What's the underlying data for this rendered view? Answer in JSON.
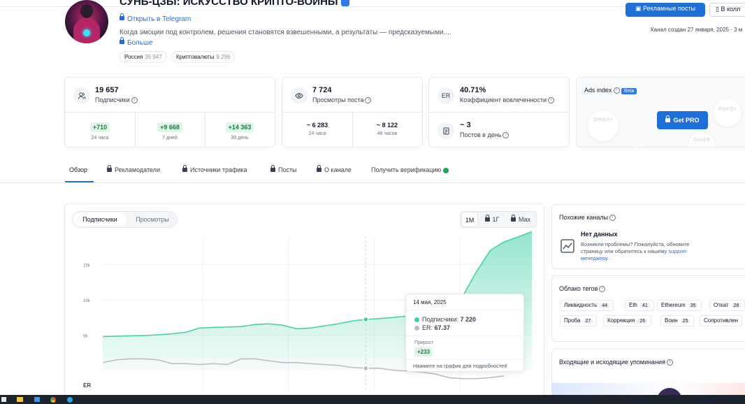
{
  "channel": {
    "title": "СУНЬ-ЦЗЫ: ИСКУССТВО КРИПТО-ВОЙНЫ",
    "telegram_link": "Открыть в Telegram",
    "description": "Когда эмоции под контролем, решения становятся взвешенными, а результаты — предсказуемыми....",
    "more": "Больше",
    "tags": [
      {
        "label": "Россия",
        "count": "35 947"
      },
      {
        "label": "Криптовалюты",
        "count": "9 296"
      }
    ],
    "ads_button": "Рекламные посты",
    "collection_button": "В колл",
    "created": "Канал создан 27 января, 2025 · 3 м"
  },
  "stats": {
    "subscribers": {
      "value": "19 657",
      "label": "Подписчики",
      "cells": [
        {
          "value": "+710",
          "label": "24 часа"
        },
        {
          "value": "+9 668",
          "label": "7 дней"
        },
        {
          "value": "+14 363",
          "label": "30 день"
        }
      ]
    },
    "views": {
      "value": "7 724",
      "label": "Просмотры поста",
      "cells": [
        {
          "value": "~ 6 283",
          "label": "24 часа"
        },
        {
          "value": "~ 8 122",
          "label": "48 часов"
        }
      ]
    },
    "er": {
      "icon_text": "ER",
      "value": "40.71%",
      "label": "Коэффициент вовлеченности"
    },
    "posts": {
      "value": "~ 3",
      "label": "Постов в день"
    },
    "ads_index": {
      "label": "Ads index",
      "beta": "Beta",
      "button": "Get PRO",
      "grades": [
        "Great A+",
        "Good B",
        "Poor D+"
      ]
    }
  },
  "tabs": [
    {
      "label": "Обзор",
      "locked": false,
      "active": true
    },
    {
      "label": "Рекламодатели",
      "locked": true
    },
    {
      "label": "Источники трафика",
      "locked": true
    },
    {
      "label": "Посты",
      "locked": true
    },
    {
      "label": "О канале",
      "locked": true
    },
    {
      "label": "Получить верификацию",
      "locked": false
    }
  ],
  "chart_controls": {
    "toggle": [
      "Подписчики",
      "Просмотры"
    ],
    "ranges": [
      "1М",
      "1Г",
      "Max"
    ]
  },
  "chart_data": {
    "type": "area",
    "ytick_labels": [
      "15k",
      "10k",
      "5k"
    ],
    "y_axis_label": "ER",
    "ylim": [
      0,
      19000
    ],
    "grid": true,
    "series": [
      {
        "name": "Подписчики",
        "values": [
          4800,
          4850,
          4900,
          4950,
          5050,
          5200,
          5400,
          6000,
          6100,
          6150,
          6200,
          6500,
          6600,
          6400,
          5900,
          6000,
          6300,
          6600,
          7000,
          7220,
          7350,
          7500,
          7700,
          8000,
          8400,
          9000,
          10500,
          14000,
          17000,
          18200,
          18900,
          19657
        ]
      },
      {
        "name": "ER",
        "values": [
          3.2,
          3.5,
          3.6,
          3.6,
          3.5,
          3.1,
          3.1,
          3.0,
          3.1,
          3.0,
          3.6,
          3.6,
          3.4,
          3.2,
          3.2,
          3.1,
          3.0,
          2.9,
          2.7,
          2.6,
          2.6,
          2.4,
          2.3,
          2.2,
          2.0,
          1.6,
          1.5,
          1.5,
          1.6,
          1.8
        ]
      }
    ],
    "highlight_index": 19
  },
  "tooltip": {
    "date": "14 мая, 2025",
    "subs_label": "Подписчики:",
    "subs_value": "7 220",
    "er_label": "ER:",
    "er_value": "67.37",
    "growth_label": "Прирост",
    "growth_value": "+233",
    "hint": "Нажмите на график для подробностей"
  },
  "similar": {
    "title": "Похожие каналы",
    "empty_title": "Нет данных",
    "empty_text_1": "Возникли проблемы? Пожалуйста, обновите",
    "empty_text_2": "страницу или обратитесь к нашему",
    "support_link_1": "support-",
    "support_link_2": "менеджеру"
  },
  "tag_cloud": {
    "title": "Облако тегов",
    "row1": [
      {
        "label": "Ликвидность",
        "count": "44"
      },
      {
        "label": "Eth",
        "count": "41"
      },
      {
        "label": "Ethereum",
        "count": "35"
      },
      {
        "label": "Откат",
        "count": "28"
      }
    ],
    "row2": [
      {
        "label": "Проба",
        "count": "27"
      },
      {
        "label": "Коррекция",
        "count": "26"
      },
      {
        "label": "Воин",
        "count": "25"
      },
      {
        "label": "Сопротивлен",
        "count": ""
      }
    ]
  },
  "mentions": {
    "title": "Входящие и исходящие упоминания"
  },
  "colors": {
    "accent": "#1f6fd8",
    "subs_line": "#3fd0a6",
    "er_line": "#b8bcc6",
    "green": "#22a55b"
  }
}
